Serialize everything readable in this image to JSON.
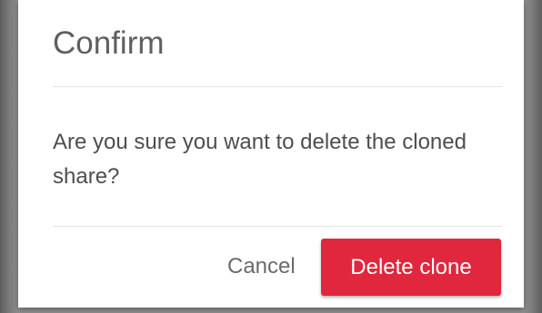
{
  "dialog": {
    "title": "Confirm",
    "message": "Are you sure you want to delete the cloned share?",
    "cancel_label": "Cancel",
    "confirm_label": "Delete clone"
  },
  "colors": {
    "danger": "#e0273d",
    "title_text": "#5f5f5f",
    "body_text": "#4e4e4e",
    "backdrop": "#8f8f8f"
  }
}
